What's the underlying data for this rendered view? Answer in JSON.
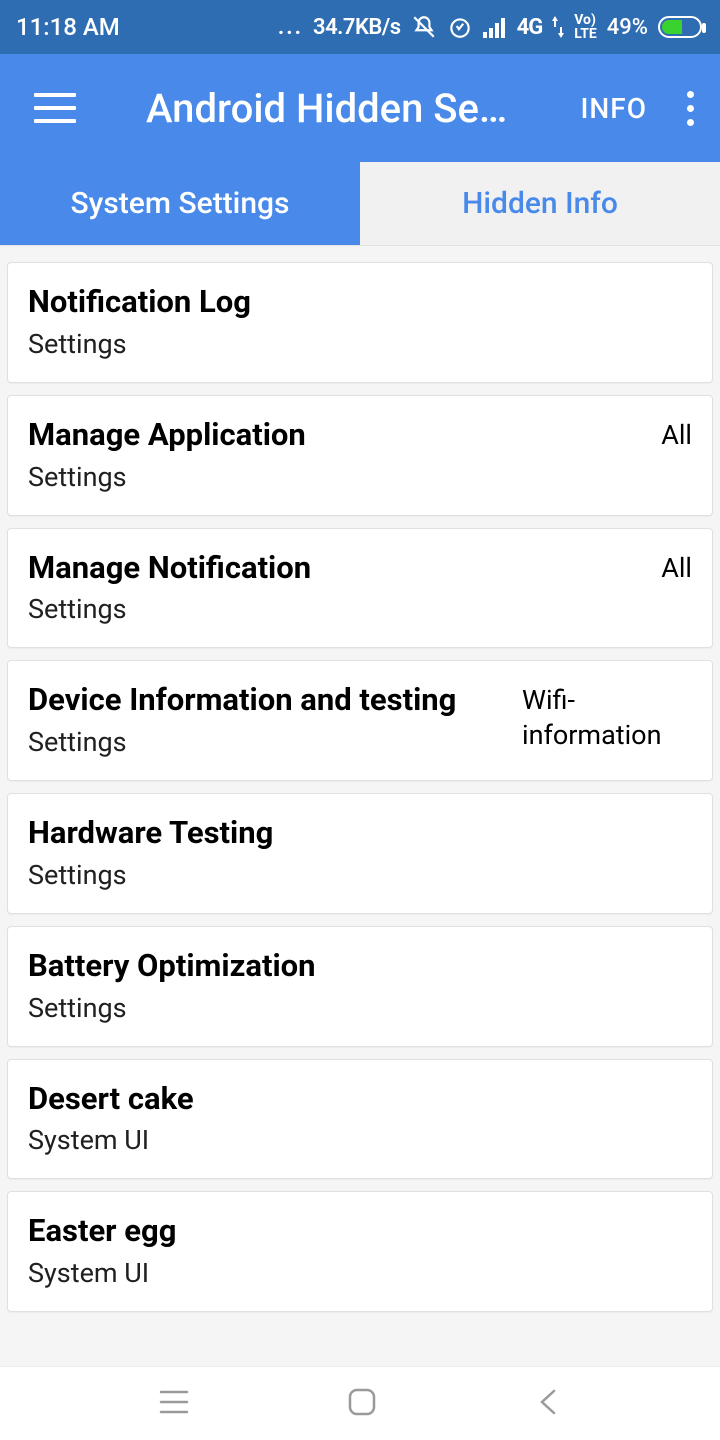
{
  "colors": {
    "status_bg": "#2f6db2",
    "appbar_bg": "#4889e9",
    "battery_fill": "#3ad22e"
  },
  "status": {
    "time": "11:18 AM",
    "net_speed": "34.7KB/s",
    "signal_label": "4G",
    "volte_top": "Vo)",
    "volte_bottom": "LTE",
    "battery_pct": "49%",
    "dots": "..."
  },
  "appbar": {
    "title": "Android Hidden Se…",
    "info_label": "INFO"
  },
  "tabs": {
    "system": "System Settings",
    "hidden": "Hidden Info"
  },
  "items": [
    {
      "title": "Notification Log",
      "sub": "Settings",
      "right": ""
    },
    {
      "title": "Manage Application",
      "sub": "Settings",
      "right": "All"
    },
    {
      "title": "Manage Notification",
      "sub": "Settings",
      "right": "All"
    },
    {
      "title": "Device Information and testing",
      "sub": "Settings",
      "right": "Wifi-information"
    },
    {
      "title": "Hardware Testing",
      "sub": "Settings",
      "right": ""
    },
    {
      "title": "Battery Optimization",
      "sub": "Settings",
      "right": ""
    },
    {
      "title": "Desert cake",
      "sub": "System UI",
      "right": ""
    },
    {
      "title": "Easter egg",
      "sub": "System UI",
      "right": ""
    }
  ]
}
